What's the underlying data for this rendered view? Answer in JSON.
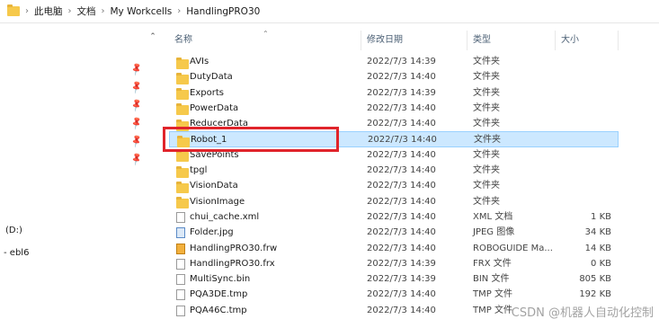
{
  "address_bar": {
    "crumbs": [
      "此电脑",
      "文档",
      "My Workcells",
      "HandlingPRO30"
    ]
  },
  "nav": {
    "drive_label": "(D:)",
    "other_label": "- ebl6"
  },
  "columns": {
    "name": "名称",
    "date": "修改日期",
    "type": "类型",
    "size": "大小"
  },
  "files": [
    {
      "name": "AVIs",
      "date": "2022/7/3 14:39",
      "type": "文件夹",
      "size": "",
      "icon": "folder-icon"
    },
    {
      "name": "DutyData",
      "date": "2022/7/3 14:40",
      "type": "文件夹",
      "size": "",
      "icon": "folder-icon"
    },
    {
      "name": "Exports",
      "date": "2022/7/3 14:39",
      "type": "文件夹",
      "size": "",
      "icon": "folder-icon"
    },
    {
      "name": "PowerData",
      "date": "2022/7/3 14:40",
      "type": "文件夹",
      "size": "",
      "icon": "folder-icon"
    },
    {
      "name": "ReducerData",
      "date": "2022/7/3 14:40",
      "type": "文件夹",
      "size": "",
      "icon": "folder-icon"
    },
    {
      "name": "Robot_1",
      "date": "2022/7/3 14:40",
      "type": "文件夹",
      "size": "",
      "icon": "folder-icon"
    },
    {
      "name": "SavePoints",
      "date": "2022/7/3 14:40",
      "type": "文件夹",
      "size": "",
      "icon": "folder-icon"
    },
    {
      "name": "tpgl",
      "date": "2022/7/3 14:40",
      "type": "文件夹",
      "size": "",
      "icon": "folder-icon"
    },
    {
      "name": "VisionData",
      "date": "2022/7/3 14:40",
      "type": "文件夹",
      "size": "",
      "icon": "folder-icon"
    },
    {
      "name": "VisionImage",
      "date": "2022/7/3 14:40",
      "type": "文件夹",
      "size": "",
      "icon": "folder-icon"
    },
    {
      "name": "chui_cache.xml",
      "date": "2022/7/3 14:40",
      "type": "XML 文档",
      "size": "1 KB",
      "icon": "file-icon"
    },
    {
      "name": "Folder.jpg",
      "date": "2022/7/3 14:40",
      "type": "JPEG 图像",
      "size": "34 KB",
      "icon": "image-file-icon"
    },
    {
      "name": "HandlingPRO30.frw",
      "date": "2022/7/3 14:40",
      "type": "ROBOGUIDE Ma...",
      "size": "14 KB",
      "icon": "roboguide-file-icon"
    },
    {
      "name": "HandlingPRO30.frx",
      "date": "2022/7/3 14:39",
      "type": "FRX 文件",
      "size": "0 KB",
      "icon": "file-icon"
    },
    {
      "name": "MultiSync.bin",
      "date": "2022/7/3 14:39",
      "type": "BIN 文件",
      "size": "805 KB",
      "icon": "file-icon"
    },
    {
      "name": "PQA3DE.tmp",
      "date": "2022/7/3 14:40",
      "type": "TMP 文件",
      "size": "192 KB",
      "icon": "file-icon"
    },
    {
      "name": "PQA46C.tmp",
      "date": "2022/7/3 14:40",
      "type": "TMP 文件",
      "size": "",
      "icon": "file-icon"
    }
  ],
  "selected_index": 5,
  "watermark": "CSDN @机器人自动化控制",
  "colors": {
    "selection_bg": "#cce8ff",
    "highlight_border": "#e0242b",
    "folder": "#f6c94b"
  }
}
